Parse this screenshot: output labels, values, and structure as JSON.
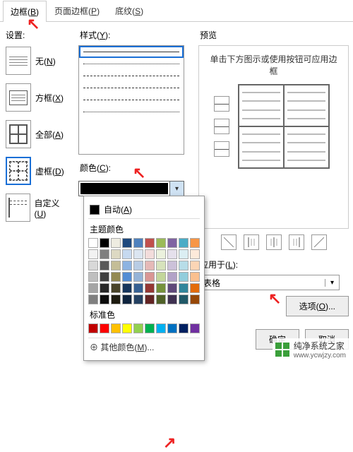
{
  "tabs": {
    "border": "边框",
    "border_mn": "B",
    "page_border": "页面边框",
    "page_border_mn": "P",
    "shading": "底纹",
    "shading_mn": "S"
  },
  "settings": {
    "label": "设置:",
    "none": "无",
    "none_mn": "N",
    "box": "方框",
    "box_mn": "X",
    "all": "全部",
    "all_mn": "A",
    "grid": "虚框",
    "grid_mn": "D",
    "custom": "自定义",
    "custom_mn": "U"
  },
  "style": {
    "label": "样式",
    "label_mn": "Y"
  },
  "color": {
    "label": "颜色",
    "label_mn": "C",
    "auto": "自动",
    "auto_mn": "A",
    "theme_label": "主题颜色",
    "standard_label": "标准色",
    "more": "其他颜色",
    "more_mn": "M",
    "theme": [
      "#ffffff",
      "#000000",
      "#eeece1",
      "#1f497d",
      "#4f81bd",
      "#c0504d",
      "#9bbb59",
      "#8064a2",
      "#4bacc6",
      "#f79646",
      "#f2f2f2",
      "#7f7f7f",
      "#ddd9c3",
      "#c6d9f0",
      "#dbe5f1",
      "#f2dcdb",
      "#ebf1dd",
      "#e5e0ec",
      "#dbeef3",
      "#fdeada",
      "#d8d8d8",
      "#595959",
      "#c4bd97",
      "#8db3e2",
      "#b8cce4",
      "#e5b9b7",
      "#d7e3bc",
      "#ccc1d9",
      "#b7dde8",
      "#fbd5b5",
      "#bfbfbf",
      "#3f3f3f",
      "#938953",
      "#548dd4",
      "#95b3d7",
      "#d99694",
      "#c3d69b",
      "#b2a2c7",
      "#92cddc",
      "#fac08f",
      "#a5a5a5",
      "#262626",
      "#494429",
      "#17365d",
      "#366092",
      "#953734",
      "#76923c",
      "#5f497a",
      "#31859b",
      "#e36c09",
      "#7f7f7f",
      "#0c0c0c",
      "#1d1b10",
      "#0f243e",
      "#244061",
      "#632423",
      "#4f6128",
      "#3f3151",
      "#205867",
      "#974806"
    ],
    "standard": [
      "#c00000",
      "#ff0000",
      "#ffc000",
      "#ffff00",
      "#92d050",
      "#00b050",
      "#00b0f0",
      "#0070c0",
      "#002060",
      "#7030a0"
    ]
  },
  "preview": {
    "label": "预览",
    "hint": "单击下方图示或使用按钮可应用边框"
  },
  "apply": {
    "label": "应用于",
    "label_mn": "L",
    "value": "表格"
  },
  "options": {
    "label": "选项",
    "label_mn": "O"
  },
  "buttons": {
    "ok": "确定",
    "cancel": "取消"
  },
  "watermark": {
    "name": "纯净系统之家",
    "url": "www.ycwjzy.com"
  }
}
